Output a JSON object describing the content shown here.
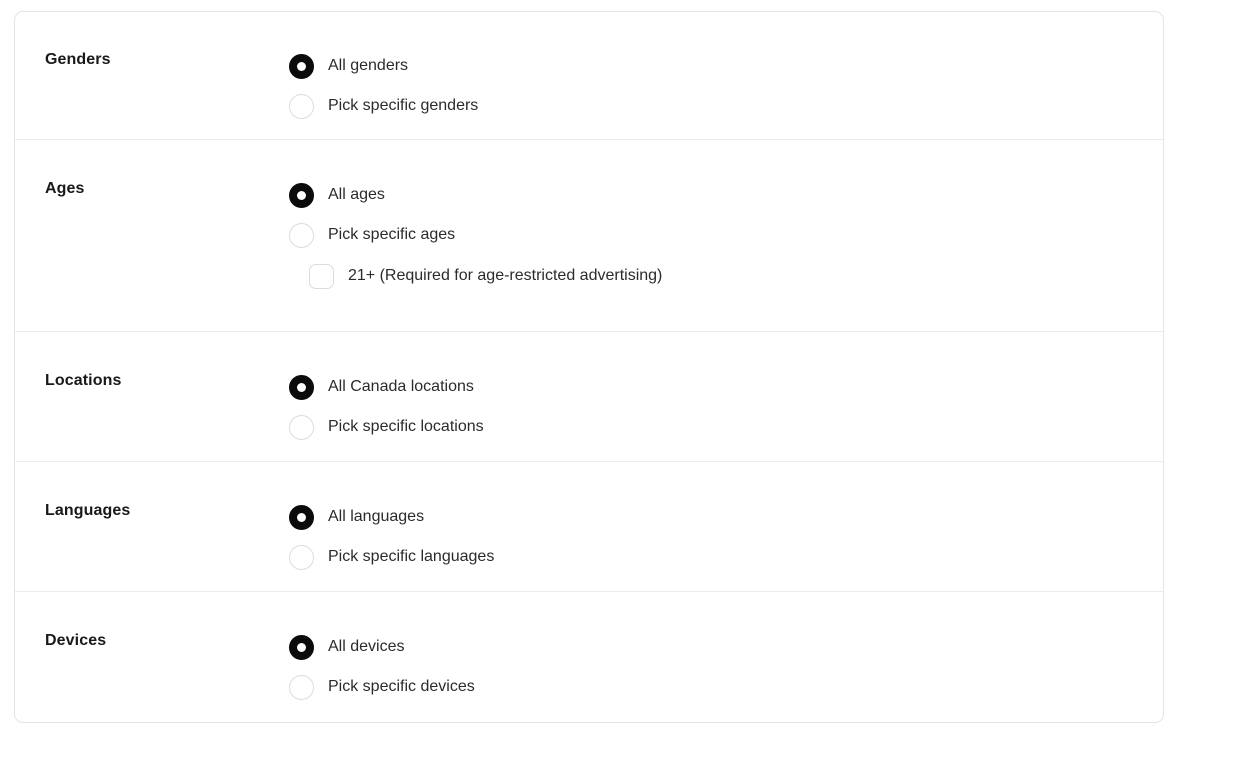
{
  "page": {
    "background_color": "#ffffff",
    "card_border_color": "#e4e4e4",
    "divider_color": "#ededed",
    "accent_color": "#0b0b0b",
    "label_color": "#18191a",
    "option_text_color": "#2b2b2b",
    "scrollbar_color": "#e6e6e6"
  },
  "sections": [
    {
      "id": "genders",
      "label": "Genders",
      "options": [
        {
          "control": "radio",
          "label": "All genders",
          "selected": true,
          "indented": false
        },
        {
          "control": "radio",
          "label": "Pick specific genders",
          "selected": false,
          "indented": false
        }
      ]
    },
    {
      "id": "ages",
      "label": "Ages",
      "options": [
        {
          "control": "radio",
          "label": "All ages",
          "selected": true,
          "indented": false
        },
        {
          "control": "radio",
          "label": "Pick specific ages",
          "selected": false,
          "indented": false
        },
        {
          "control": "checkbox",
          "label": "21+ (Required for age-restricted advertising)",
          "selected": false,
          "indented": true
        }
      ]
    },
    {
      "id": "locations",
      "label": "Locations",
      "options": [
        {
          "control": "radio",
          "label": "All Canada locations",
          "selected": true,
          "indented": false
        },
        {
          "control": "radio",
          "label": "Pick specific locations",
          "selected": false,
          "indented": false
        }
      ]
    },
    {
      "id": "languages",
      "label": "Languages",
      "options": [
        {
          "control": "radio",
          "label": "All languages",
          "selected": true,
          "indented": false
        },
        {
          "control": "radio",
          "label": "Pick specific languages",
          "selected": false,
          "indented": false
        }
      ]
    },
    {
      "id": "devices",
      "label": "Devices",
      "options": [
        {
          "control": "radio",
          "label": "All devices",
          "selected": true,
          "indented": false
        },
        {
          "control": "radio",
          "label": "Pick specific devices",
          "selected": false,
          "indented": false
        }
      ]
    }
  ]
}
